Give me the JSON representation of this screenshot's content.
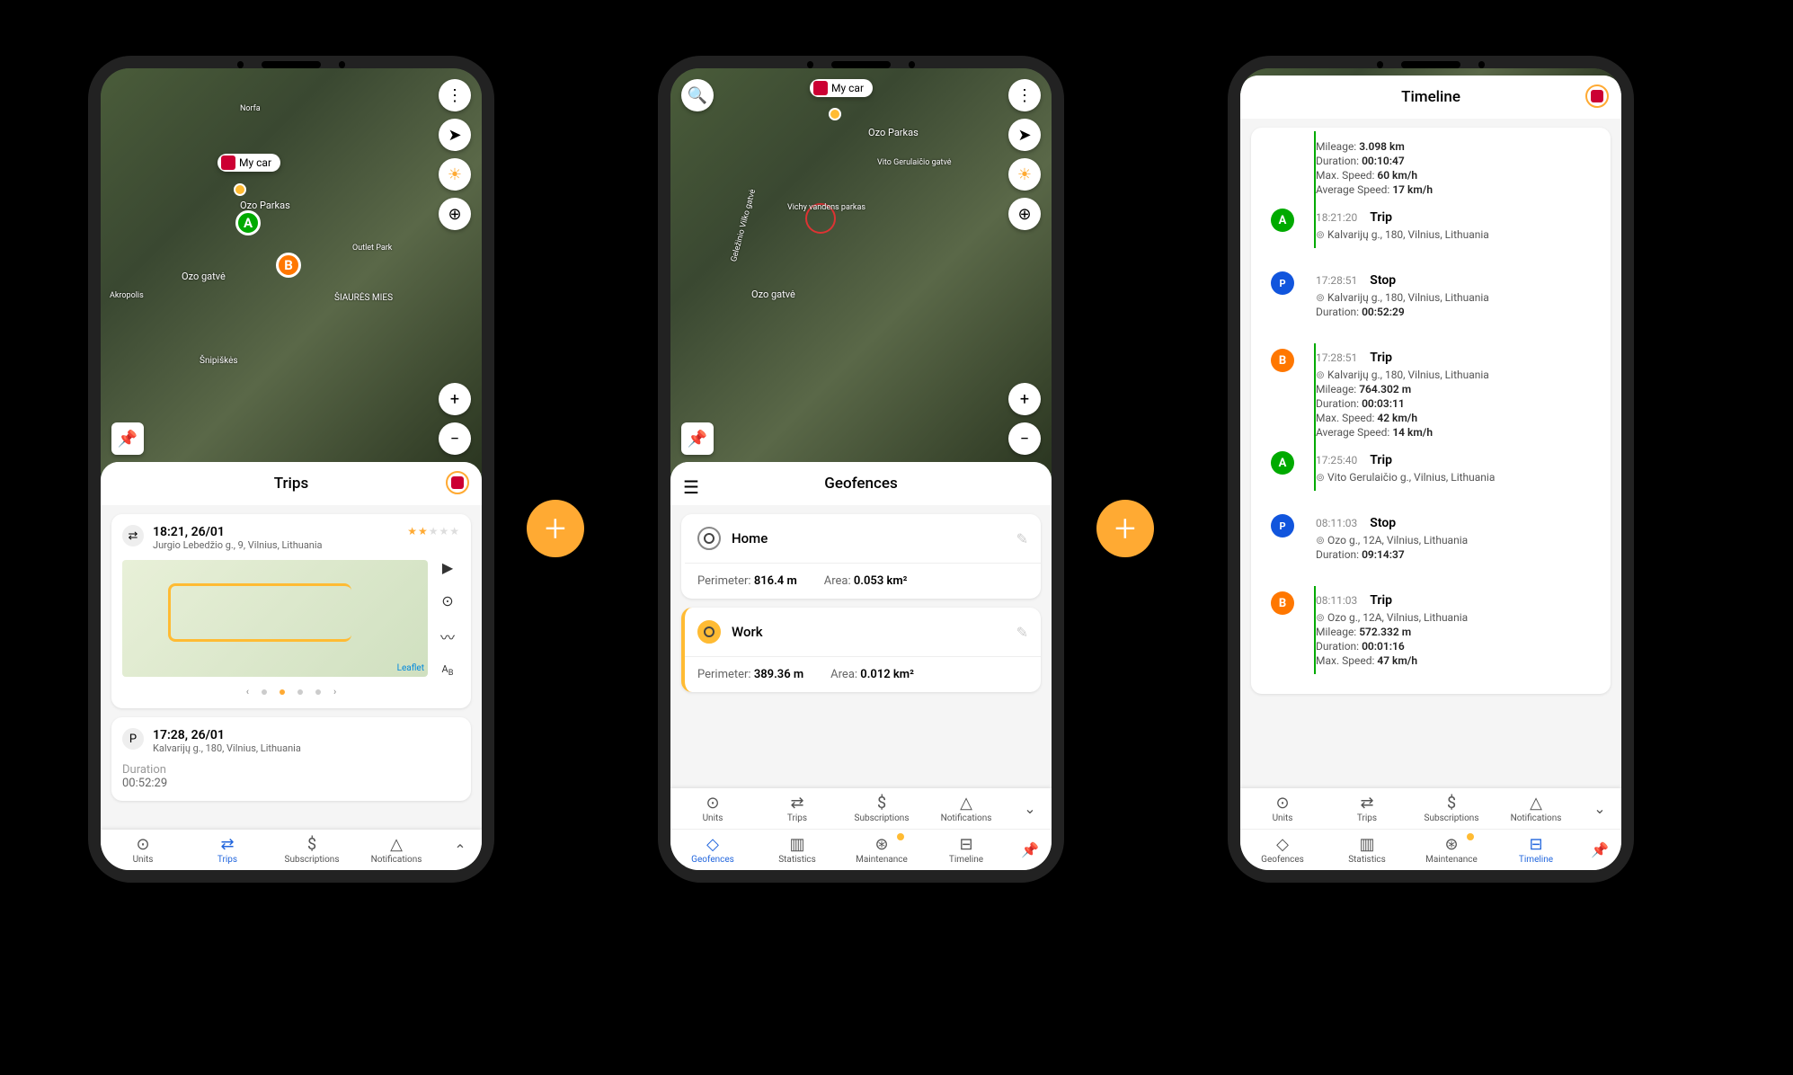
{
  "unit_label": "My car",
  "phone1": {
    "title": "Trips",
    "trip1": {
      "time": "18:21, 26/01",
      "address": "Jurgio Lebedžio g., 9, Vilnius, Lithuania",
      "leaflet": "Leaflet"
    },
    "trip2": {
      "time": "17:28, 26/01",
      "address": "Kalvarijų g., 180, Vilnius, Lithuania",
      "duration_label": "Duration",
      "duration": "00:52:29"
    },
    "nav": [
      "Units",
      "Trips",
      "Subscriptions",
      "Notifications"
    ]
  },
  "phone2": {
    "title": "Geofences",
    "geo1": {
      "name": "Home",
      "perimeter_label": "Perimeter:",
      "perimeter": "816.4 m",
      "area_label": "Area:",
      "area": "0.053 km²"
    },
    "geo2": {
      "name": "Work",
      "perimeter_label": "Perimeter:",
      "perimeter": "389.36 m",
      "area_label": "Area:",
      "area": "0.012 km²"
    },
    "nav1": [
      "Units",
      "Trips",
      "Subscriptions",
      "Notifications"
    ],
    "nav2": [
      "Geofences",
      "Statistics",
      "Maintenance",
      "Timeline"
    ]
  },
  "phone3": {
    "title": "Timeline",
    "partial": {
      "mileage_label": "Mileage:",
      "mileage": "3.098 km",
      "duration_label": "Duration:",
      "duration": "00:10:47",
      "max_label": "Max. Speed:",
      "max": "60 km/h",
      "avg_label": "Average Speed:",
      "avg": "17 km/h"
    },
    "items": [
      {
        "marker": "A",
        "time": "18:21:20",
        "type": "Trip",
        "addr": "Kalvarijų g., 180, Vilnius, Lithuania"
      },
      {
        "marker": "P",
        "time": "17:28:51",
        "type": "Stop",
        "addr": "Kalvarijų g., 180, Vilnius, Lithuania",
        "duration_label": "Duration:",
        "duration": "00:52:29"
      },
      {
        "marker": "B",
        "time": "17:28:51",
        "type": "Trip",
        "addr": "Kalvarijų g., 180, Vilnius, Lithuania",
        "mileage_label": "Mileage:",
        "mileage": "764.302 m",
        "duration_label": "Duration:",
        "duration": "00:03:11",
        "max_label": "Max. Speed:",
        "max": "42 km/h",
        "avg_label": "Average Speed:",
        "avg": "14 km/h"
      },
      {
        "marker": "A",
        "time": "17:25:40",
        "type": "Trip",
        "addr": "Vito Gerulaičio g., Vilnius, Lithuania"
      },
      {
        "marker": "P",
        "time": "08:11:03",
        "type": "Stop",
        "addr": "Ozo g., 12A, Vilnius, Lithuania",
        "duration_label": "Duration:",
        "duration": "09:14:37"
      },
      {
        "marker": "B",
        "time": "08:11:03",
        "type": "Trip",
        "addr": "Ozo g., 12A, Vilnius, Lithuania",
        "mileage_label": "Mileage:",
        "mileage": "572.332 m",
        "duration_label": "Duration:",
        "duration": "00:01:16",
        "max_label": "Max. Speed:",
        "max": "47 km/h"
      }
    ],
    "nav1": [
      "Units",
      "Trips",
      "Subscriptions",
      "Notifications"
    ],
    "nav2": [
      "Geofences",
      "Statistics",
      "Maintenance",
      "Timeline"
    ]
  },
  "map_labels": {
    "ozo": "Ozo Parkas",
    "ozogatve": "Ozo gatvė",
    "akropolis": "Akropolis",
    "outlet": "Outlet Park",
    "norfa": "Norfa",
    "siaures": "ŠIAURĖS MIES",
    "snipskes": "Šnipiškės",
    "vichy": "Vichy vandens parkas",
    "vito": "Vito Gerulaičio gatvė",
    "gelezinio": "Geležinio Vilko gatvė"
  }
}
